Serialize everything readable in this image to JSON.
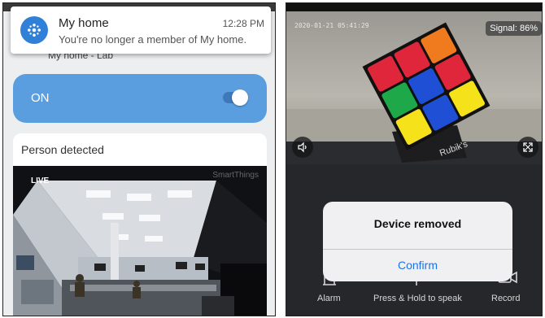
{
  "left": {
    "notification": {
      "title": "My home",
      "time": "12:28 PM",
      "body": "You're no longer a member of My home."
    },
    "behind_text": "My home - Lab",
    "toggle": {
      "label": "ON",
      "state": "on"
    },
    "camera_card": {
      "title": "Person detected",
      "live_label": "LIVE",
      "brand": "SmartThings"
    }
  },
  "right": {
    "timestamp": "2020-01-21 05:41:29",
    "signal": "Signal: 86%",
    "controls": [
      {
        "label": "Alarm",
        "icon": "alarm-icon"
      },
      {
        "label": "Press & Hold to speak",
        "icon": "microphone-icon"
      },
      {
        "label": "Record",
        "icon": "video-record-icon"
      }
    ],
    "dialog": {
      "title": "Device removed",
      "confirm_label": "Confirm"
    }
  },
  "colors": {
    "accent_blue": "#2f80d6",
    "toggle_blue": "#5b9ee0",
    "confirm_blue": "#1b73e8"
  }
}
